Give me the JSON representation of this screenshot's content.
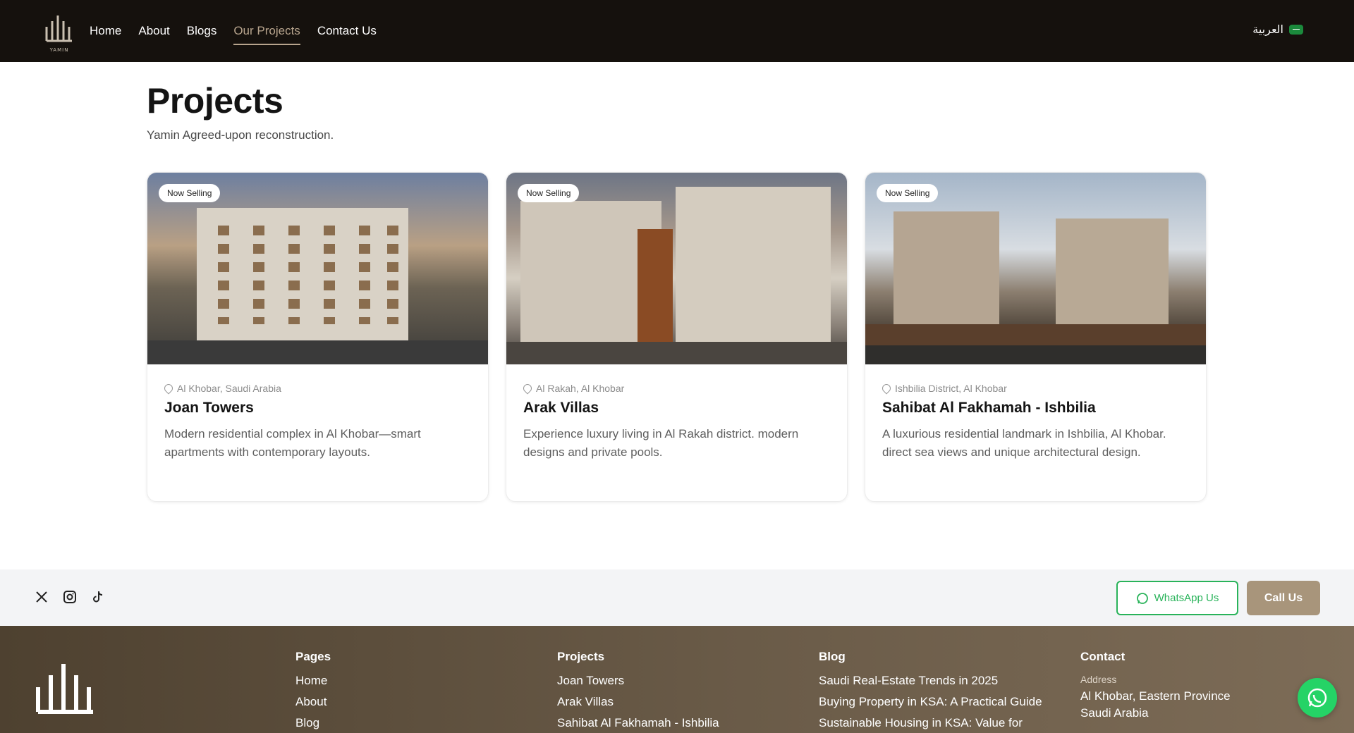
{
  "nav": {
    "logo_text": "YAMIN",
    "links": [
      {
        "label": "Home"
      },
      {
        "label": "About"
      },
      {
        "label": "Blogs"
      },
      {
        "label": "Our Projects",
        "active": true
      },
      {
        "label": "Contact Us"
      }
    ],
    "language_label": "العربية",
    "flag_icon": "saudi-flag-icon"
  },
  "header": {
    "title": "Projects",
    "subtitle": "Yamin Agreed-upon reconstruction."
  },
  "projects": [
    {
      "badge": "Now Selling",
      "location": "Al Khobar, Saudi Arabia",
      "title": "Joan Towers",
      "description": "Modern residential complex in Al Khobar—smart apartments with contemporary layouts."
    },
    {
      "badge": "Now Selling",
      "location": "Al Rakah, Al Khobar",
      "title": "Arak Villas",
      "description": "Experience luxury living in Al Rakah district. modern designs and private pools."
    },
    {
      "badge": "Now Selling",
      "location": "Ishbilia District, Al Khobar",
      "title": "Sahibat Al Fakhamah - Ishbilia",
      "description": "A luxurious residential landmark in Ishbilia, Al Khobar. direct sea views and unique architectural design."
    }
  ],
  "cta": {
    "social_icons": [
      "x-icon",
      "instagram-icon",
      "tiktok-icon"
    ],
    "whatsapp_label": "WhatsApp Us",
    "call_label": "Call Us",
    "whatsapp_color": "#29b35a",
    "call_color": "#a8957b"
  },
  "footer": {
    "pages": {
      "heading": "Pages",
      "links": [
        "Home",
        "About",
        "Blog"
      ]
    },
    "projects": {
      "heading": "Projects",
      "links": [
        "Joan Towers",
        "Arak Villas",
        "Sahibat Al Fakhamah - Ishbilia"
      ]
    },
    "blog": {
      "heading": "Blog",
      "links": [
        "Saudi Real-Estate Trends in 2025",
        "Buying Property in KSA: A Practical Guide",
        "Sustainable Housing in KSA: Value for"
      ]
    },
    "contact": {
      "heading": "Contact",
      "address_label": "Address",
      "address_line1": "Al Khobar, Eastern Province",
      "address_line2": "Saudi Arabia"
    }
  }
}
